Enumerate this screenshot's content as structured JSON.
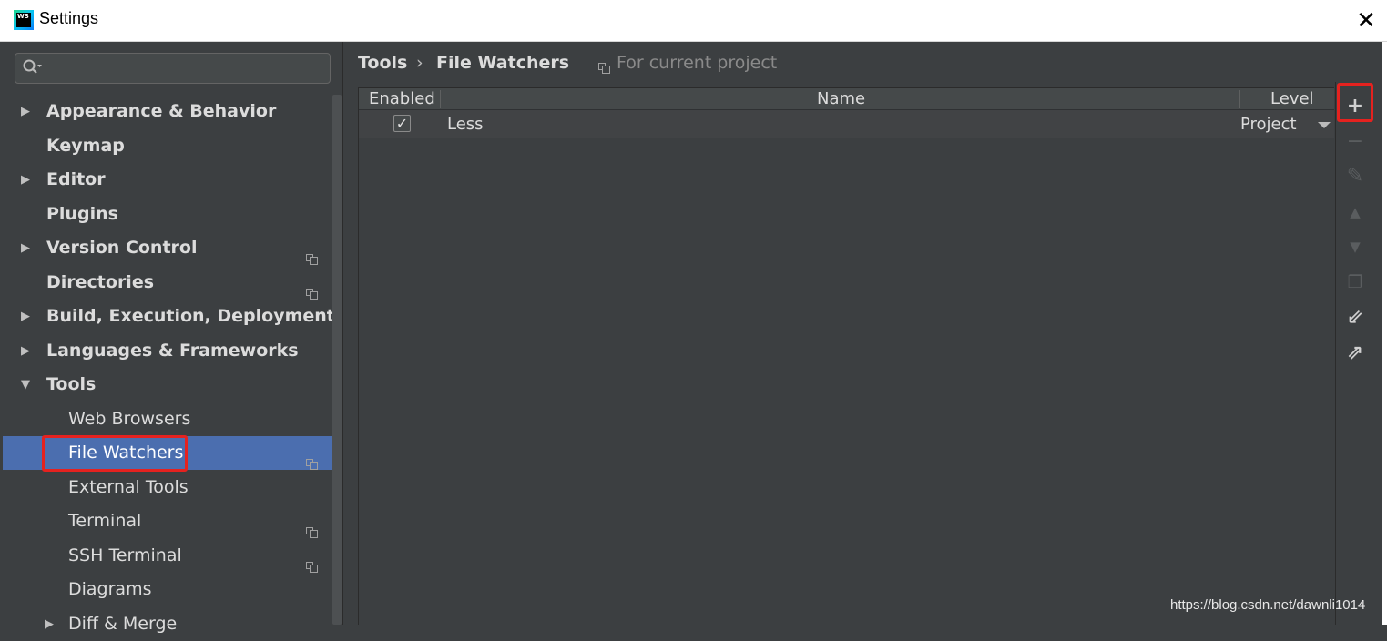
{
  "window": {
    "title": "Settings",
    "app_icon": "webstorm-icon",
    "app_icon_text": "WS",
    "close_glyph": "✕"
  },
  "search": {
    "placeholder": "",
    "value": ""
  },
  "sidebar": {
    "items": [
      {
        "label": "Appearance & Behavior",
        "expander": "collapsed",
        "bold": true,
        "project_scoped": false
      },
      {
        "label": "Keymap",
        "expander": "none",
        "bold": true,
        "project_scoped": false
      },
      {
        "label": "Editor",
        "expander": "collapsed",
        "bold": true,
        "project_scoped": false
      },
      {
        "label": "Plugins",
        "expander": "none",
        "bold": true,
        "project_scoped": false
      },
      {
        "label": "Version Control",
        "expander": "collapsed",
        "bold": true,
        "project_scoped": true
      },
      {
        "label": "Directories",
        "expander": "none",
        "bold": true,
        "project_scoped": true
      },
      {
        "label": "Build, Execution, Deployment",
        "expander": "collapsed",
        "bold": true,
        "project_scoped": false
      },
      {
        "label": "Languages & Frameworks",
        "expander": "collapsed",
        "bold": true,
        "project_scoped": false
      },
      {
        "label": "Tools",
        "expander": "expanded",
        "bold": true,
        "project_scoped": false
      },
      {
        "label": "Web Browsers",
        "expander": "none",
        "bold": false,
        "project_scoped": false
      },
      {
        "label": "File Watchers",
        "expander": "none",
        "bold": false,
        "project_scoped": true,
        "selected": true,
        "highlighted": true
      },
      {
        "label": "External Tools",
        "expander": "none",
        "bold": false,
        "project_scoped": false
      },
      {
        "label": "Terminal",
        "expander": "none",
        "bold": false,
        "project_scoped": true
      },
      {
        "label": "SSH Terminal",
        "expander": "none",
        "bold": false,
        "project_scoped": true
      },
      {
        "label": "Diagrams",
        "expander": "none",
        "bold": false,
        "project_scoped": false
      },
      {
        "label": "Diff & Merge",
        "expander": "collapsed",
        "bold": false,
        "project_scoped": false
      }
    ]
  },
  "breadcrumb": {
    "parent": "Tools",
    "separator": "›",
    "current": "File Watchers",
    "scope_label": "For current project"
  },
  "table": {
    "headers": {
      "enabled": "Enabled",
      "name": "Name",
      "level": "Level"
    },
    "rows": [
      {
        "enabled": true,
        "check_glyph": "✓",
        "name": "Less",
        "level": "Project"
      }
    ]
  },
  "toolbar": {
    "buttons": [
      {
        "icon": "add-icon",
        "glyph": "+",
        "enabled": true,
        "highlighted": true
      },
      {
        "icon": "remove-icon",
        "glyph": "−",
        "enabled": false
      },
      {
        "icon": "edit-icon",
        "glyph": "✎",
        "enabled": false
      },
      {
        "icon": "move-up-icon",
        "glyph": "▲",
        "enabled": false
      },
      {
        "icon": "move-down-icon",
        "glyph": "▼",
        "enabled": false
      },
      {
        "icon": "copy-icon",
        "glyph": "❐",
        "enabled": false
      },
      {
        "icon": "import-icon",
        "glyph": "⇙",
        "enabled": true
      },
      {
        "icon": "export-icon",
        "glyph": "⇗",
        "enabled": true
      }
    ]
  },
  "watermark": "https://blog.csdn.net/dawnli1014",
  "colors": {
    "background": "#3c3f41",
    "selection": "#4b6eaf",
    "highlight_box": "#e5221f",
    "text": "#dcdcdc",
    "muted_text": "#8a8a8a"
  }
}
